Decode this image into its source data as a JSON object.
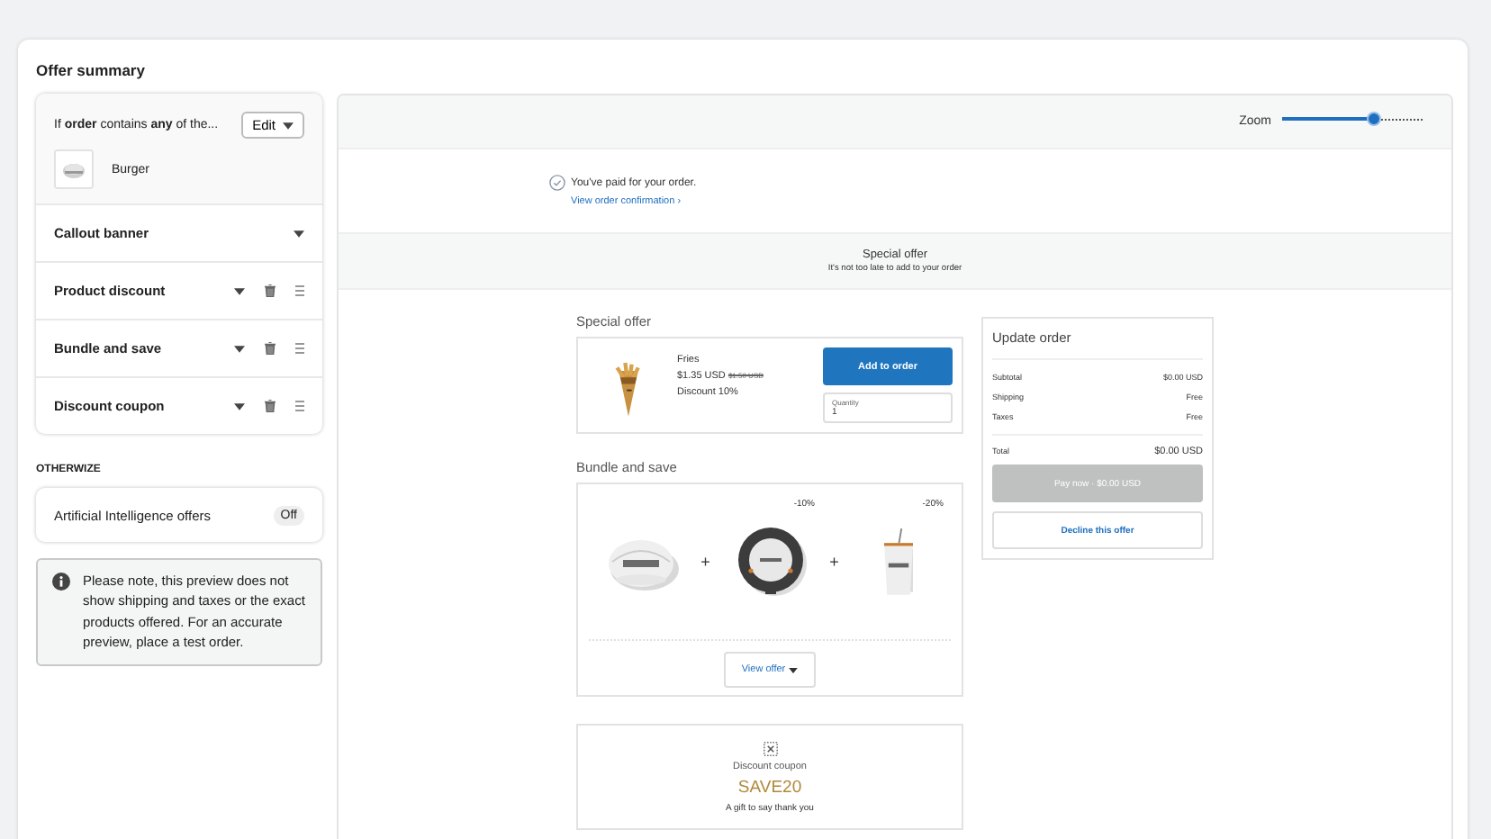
{
  "title": "Offer summary",
  "condition": {
    "text": "If **order** contains **any** of the...",
    "edit": "Edit",
    "product": "Burger"
  },
  "sections": [
    {
      "label": "Callout banner",
      "removable": false
    },
    {
      "label": "Product discount",
      "removable": true
    },
    {
      "label": "Bundle and save",
      "removable": true
    },
    {
      "label": "Discount coupon",
      "removable": true
    }
  ],
  "otherwise": {
    "heading": "OTHERWIZE",
    "label": "Artificial Intelligence offers",
    "toggle": "Off"
  },
  "note": "Please note, this preview does not show shipping and taxes or the exact products offered. For an accurate preview, place a test order.",
  "zoom": {
    "label": "Zoom",
    "level": 0.65
  },
  "paid": {
    "message": "You've paid for your order.",
    "link": "View order confirmation ›"
  },
  "offer_header": {
    "title": "Special offer",
    "subtitle": "It's not too late to add to your order"
  },
  "special_offer": {
    "heading": "Special offer",
    "name": "Fries",
    "price": "$1.35 USD",
    "old_price": "$1.50 USD",
    "discount": "Discount 10%",
    "button": "Add to order",
    "quantity_label": "Quantity",
    "quantity": "1"
  },
  "bundle": {
    "heading": "Bundle and save",
    "items": [
      {
        "kind": "picture"
      },
      {
        "kind": "picture",
        "plus": "+",
        "discount": "-10%"
      },
      {
        "kind": "picture",
        "plus": "+",
        "discount": "-20%"
      }
    ],
    "button": "View offer"
  },
  "coupon": {
    "label": "Discount coupon",
    "code": "SAVE20",
    "message": "A gift to say thank you"
  },
  "summary": {
    "title": "Update order",
    "rows": [
      {
        "label": "Subtotal",
        "value": "$0.00 USD"
      },
      {
        "label": "Shipping",
        "value": "Free"
      },
      {
        "label": "Taxes",
        "value": "Free"
      }
    ],
    "total_label": "Total",
    "total": "$0.00 USD",
    "pay": "Pay now · $0.00 USD",
    "pay_disabled": true,
    "decline": "Decline this offer"
  }
}
